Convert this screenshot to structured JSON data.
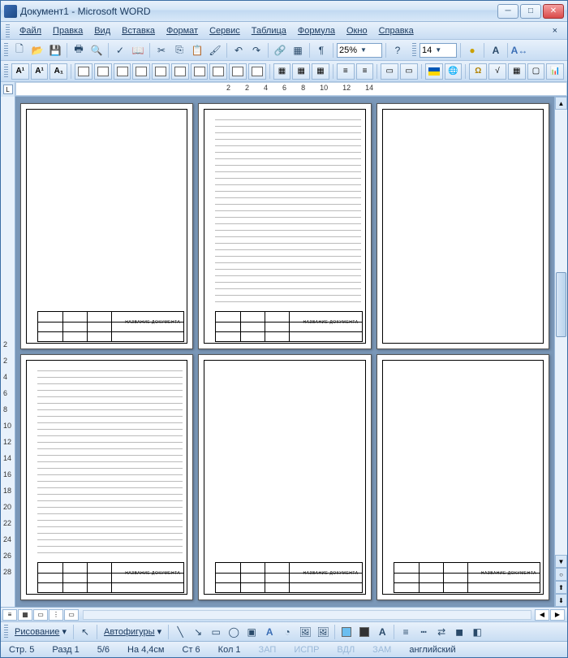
{
  "title": "Документ1 - Microsoft WORD",
  "menus": [
    "Файл",
    "Правка",
    "Вид",
    "Вставка",
    "Формат",
    "Сервис",
    "Таблица",
    "Формула",
    "Окно",
    "Справка"
  ],
  "help_x": "×",
  "toolbar1": {
    "zoom": "25%",
    "font_size": "14"
  },
  "ruler_h": [
    "2",
    "",
    "2",
    "4",
    "6",
    "8",
    "10",
    "12",
    "14"
  ],
  "ruler_v": [
    "2",
    "",
    "2",
    "4",
    "6",
    "8",
    "10",
    "12",
    "14",
    "16",
    "18",
    "20",
    "22",
    "24",
    "26",
    "28"
  ],
  "stamp_label": "НАЗВАНИЕ ДОКУМЕНТА",
  "drawing": {
    "label": "Рисование",
    "autoshapes": "Автофигуры"
  },
  "status": {
    "page": "Стр. 5",
    "section": "Разд 1",
    "pages": "5/6",
    "at": "На 4,4см",
    "line": "Ст 6",
    "col": "Кол 1",
    "zap": "ЗАП",
    "ispr": "ИСПР",
    "vdl": "ВДЛ",
    "zam": "ЗАМ",
    "lang": "английский"
  }
}
